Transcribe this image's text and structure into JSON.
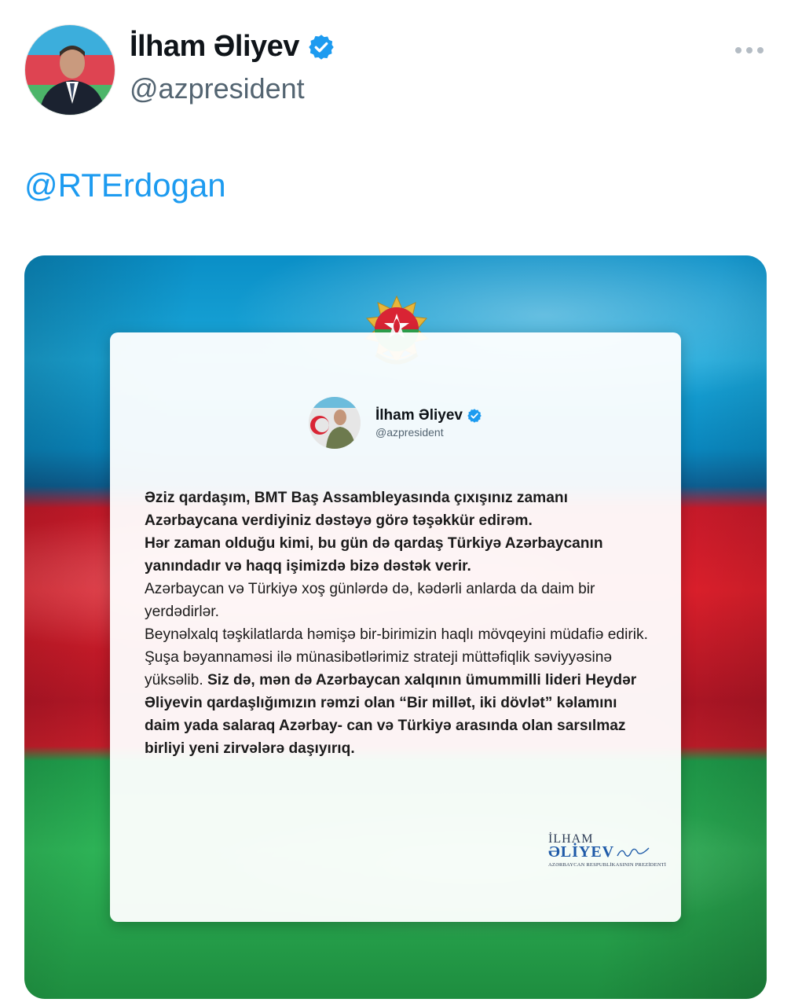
{
  "tweet": {
    "author_name": "İlham Əliyev",
    "author_handle": "@azpresident",
    "mention": "@RTErdogan",
    "verified_badge": "verified-check-icon",
    "more_menu": "more-horizontal-icon",
    "accent_color": "#1d9bf0"
  },
  "image": {
    "background": "azerbaijan-flag",
    "flag_colors": [
      "#0a8fc7",
      "#e0202c",
      "#2db256"
    ],
    "emblem": "azerbaijan-coat-of-arms",
    "card": {
      "author_name": "İlham Əliyev",
      "author_handle": "@azpresident",
      "paragraphs": [
        [
          {
            "bold": true,
            "text": "Əziz qardaşım, BMT Baş Assambleyasında çıxışınız zamanı Azərbaycana verdiyiniz dəstəyə görə təşəkkür edirəm."
          }
        ],
        [
          {
            "bold": true,
            "text": "Hər zaman olduğu kimi, bu gün də qardaş Türkiyə Azərbaycanın yanındadır və haqq işimizdə bizə dəstək verir."
          }
        ],
        [
          {
            "bold": false,
            "text": "Azərbaycan və Türkiyə xoş günlərdə də, kədərli anlarda da daim bir yerdədirlər."
          }
        ],
        [
          {
            "bold": false,
            "text": "Beynəlxalq təşkilatlarda həmişə bir-birimizin haqlı mövqeyini müdafiə edirik."
          }
        ],
        [
          {
            "bold": false,
            "text": "Şuşa bəyannaməsi ilə münasibətlərimiz strateji müttəfiqlik səviyyəsinə yüksəlib. "
          },
          {
            "bold": true,
            "text": "Siz də, mən də Azərbaycan xalqının ümummilli lideri Heydər Əliyevin qardaşlığımızın rəmzi olan “Bir millət, iki dövlət” kəlamını daim yada salaraq Azərbay- can və Türkiyə arasında olan sarsılmaz birliyi yeni zirvələrə daşıyırıq."
          }
        ]
      ],
      "signature": {
        "line1": "İLHAM",
        "line2": "ƏLİYEV",
        "line3": "AZƏRBAYCAN RESPUBLİKASININ PREZİDENTİ"
      }
    }
  }
}
